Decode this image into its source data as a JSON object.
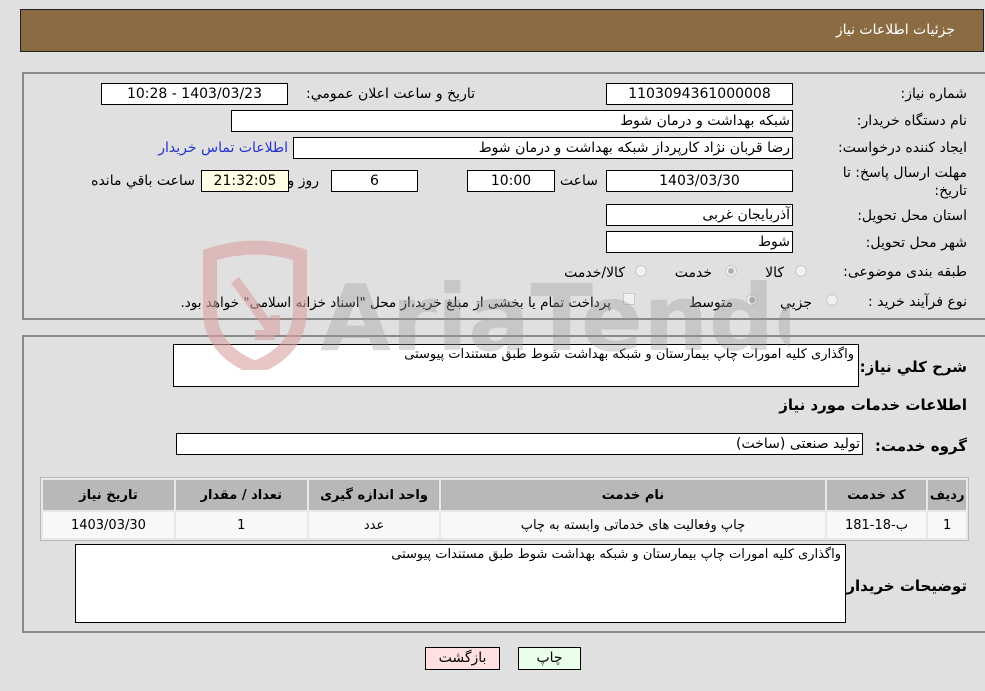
{
  "header": {
    "title": "جزئیات اطلاعات نیاز"
  },
  "form": {
    "need_number": {
      "label": "شماره نیاز:",
      "value": "1103094361000008"
    },
    "announce_datetime": {
      "label": "تاریخ و ساعت اعلان عمومي:",
      "value": "1403/03/23 - 10:28"
    },
    "buyer_org": {
      "label": "نام دستگاه خريدار:",
      "value": "شبکه بهداشت و درمان شوط"
    },
    "requester": {
      "label": "ايجاد کننده درخواست:",
      "value": "رضا قربان نژاد کارپرداز شبکه بهداشت و درمان شوط"
    },
    "buyer_contact_link": "اطلاعات تماس خريدار",
    "deadline": {
      "label_line1": "مهلت ارسال پاسخ: تا",
      "label_line2": "تاريخ:",
      "date": "1403/03/30",
      "time_label": "ساعت",
      "time": "10:00",
      "days": "6",
      "days_label": "روز و",
      "remaining": "21:32:05",
      "remaining_label": "ساعت باقي مانده"
    },
    "province": {
      "label": "استان محل تحويل:",
      "value": "آذربايجان غربی"
    },
    "city": {
      "label": "شهر محل تحويل:",
      "value": "شوط"
    },
    "category": {
      "label": "طبقه بندی موضوعی:",
      "options": [
        "کالا",
        "خدمت",
        "کالا/خدمت"
      ],
      "selected": "خدمت"
    },
    "purchase_process": {
      "label": "نوع فرآيند خريد :",
      "options": [
        "جزيي",
        "متوسط"
      ],
      "selected": "متوسط",
      "treasury_checkbox_label": "پرداخت تمام يا بخشی از مبلغ خريد،از محل \"اسناد خزانه اسلامی\" خواهد بود.",
      "treasury_checked": false
    }
  },
  "details": {
    "general_desc": {
      "label": "شرح کلي نياز:",
      "value": "واگذاری کليه امورات چاپ بيمارستان و شبکه بهداشت شوط طبق مستندات پيوستی"
    },
    "services_heading": "اطلاعات خدمات مورد نياز",
    "service_group": {
      "label": "گروه خدمت:",
      "value": "توليد صنعتی (ساخت)"
    },
    "table": {
      "headers": [
        "رديف",
        "کد خدمت",
        "نام خدمت",
        "واحد اندازه گيری",
        "تعداد / مقدار",
        "تاريخ نياز"
      ],
      "rows": [
        [
          "1",
          "ب-18-181",
          "چاپ وفعاليت های خدماتی وابسته به چاپ",
          "عدد",
          "1",
          "1403/03/30"
        ]
      ]
    },
    "buyer_notes": {
      "label": "توضيحات خريدار:",
      "value": "واگذاری کليه امورات چاپ بيمارستان و شبکه بهداشت شوط طبق مستندات پيوستی"
    }
  },
  "buttons": {
    "print": "چاپ",
    "back": "بازگشت"
  },
  "colors": {
    "header_bg": "#8b6c42",
    "link": "#2233cc",
    "print_bg": "#eaffea",
    "back_bg": "#ffe0e0",
    "remaining_bg": "#ffffe6"
  },
  "watermark": {
    "text": "AriaTender.neT"
  }
}
